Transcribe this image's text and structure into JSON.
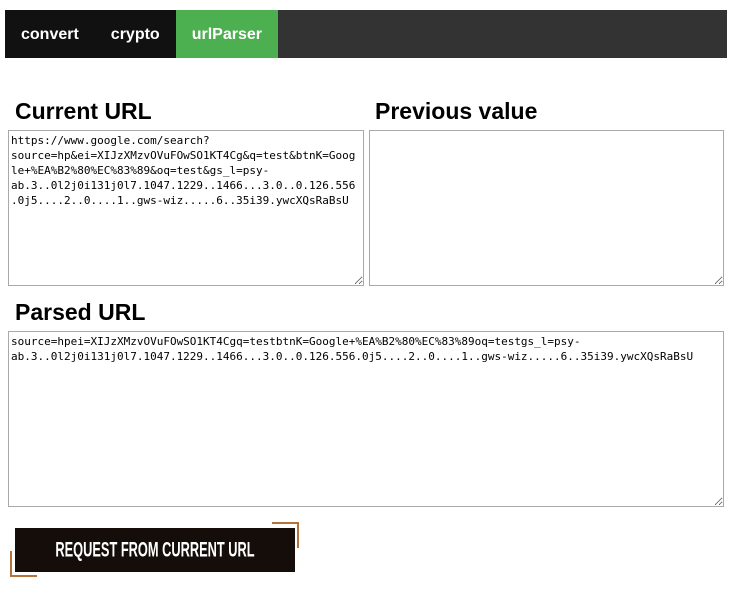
{
  "nav": {
    "tabs": [
      {
        "label": "convert",
        "active": false
      },
      {
        "label": "crypto",
        "active": false
      },
      {
        "label": "urlParser",
        "active": true
      }
    ]
  },
  "colors": {
    "nav_bg": "#333333",
    "tab_bg": "#111111",
    "active_tab_bg": "#4caf50",
    "button_bg": "#140d09",
    "button_accent": "#b5733c"
  },
  "current_url": {
    "heading": "Current URL",
    "value": "https://www.google.com/search?source=hp&ei=XIJzXMzvOVuFOwSO1KT4Cg&q=test&btnK=Google+%EA%B2%80%EC%83%89&oq=test&gs_l=psy-ab.3..0l2j0i131j0l7.1047.1229..1466...3.0..0.126.556.0j5....2..0....1..gws-wiz.....6..35i39.ywcXQsRaBsU"
  },
  "previous_value": {
    "heading": "Previous value",
    "value": ""
  },
  "parsed_url": {
    "heading": "Parsed URL",
    "value": "source=hpei=XIJzXMzvOVuFOwSO1KT4Cgq=testbtnK=Google+%EA%B2%80%EC%83%89oq=testgs_l=psy-ab.3..0l2j0i131j0l7.1047.1229..1466...3.0..0.126.556.0j5....2..0....1..gws-wiz.....6..35i39.ywcXQsRaBsU"
  },
  "request_button": {
    "label": "REQUEST FROM CURRENT URL"
  }
}
